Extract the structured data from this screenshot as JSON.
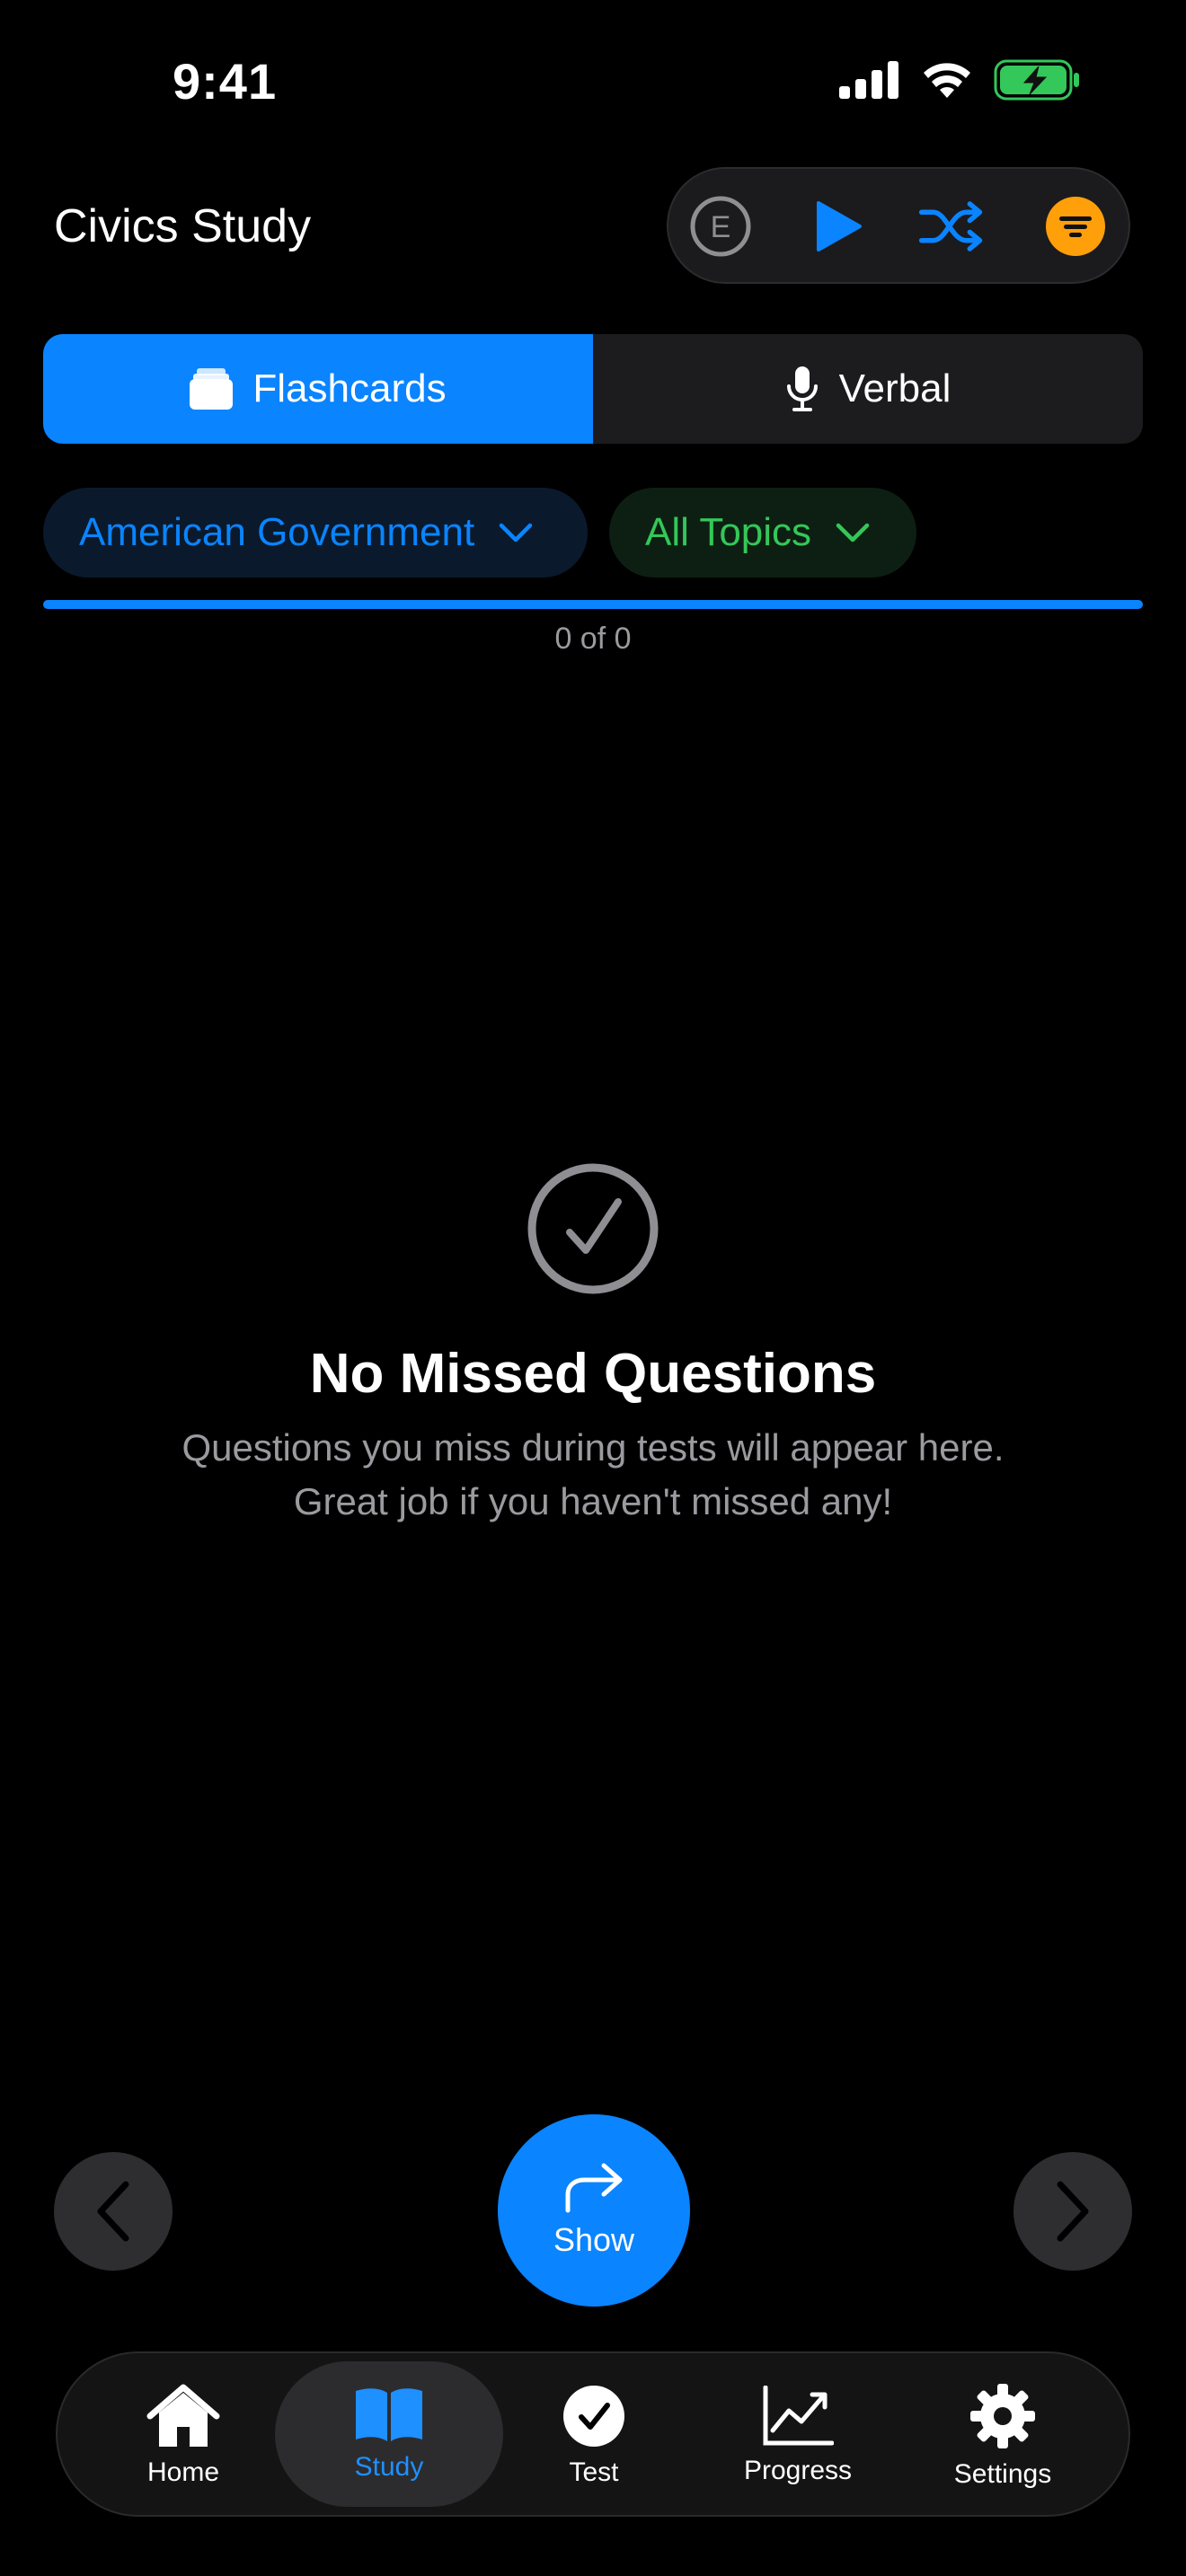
{
  "status_bar": {
    "time": "9:41"
  },
  "header": {
    "title": "Civics Study",
    "toolbar": {
      "e_label": "E",
      "icons": [
        "e-circle-icon",
        "play-icon",
        "shuffle-icon",
        "filter-icon"
      ]
    }
  },
  "segments": [
    {
      "label": "Flashcards",
      "icon": "cards-icon",
      "active": true
    },
    {
      "label": "Verbal",
      "icon": "microphone-icon",
      "active": false
    }
  ],
  "filters": {
    "category": "American Government",
    "topic": "All Topics"
  },
  "progress": {
    "text": "0 of 0",
    "fraction": 1.0
  },
  "empty_state": {
    "title": "No Missed Questions",
    "line1": "Questions you miss during tests will appear here.",
    "line2": "Great job if you haven't missed any!"
  },
  "controls": {
    "show_label": "Show"
  },
  "tabbar": {
    "items": [
      {
        "label": "Home",
        "icon": "house-icon"
      },
      {
        "label": "Study",
        "icon": "book-icon",
        "active": true
      },
      {
        "label": "Test",
        "icon": "checkmark-circle-icon"
      },
      {
        "label": "Progress",
        "icon": "chart-line-icon"
      },
      {
        "label": "Settings",
        "icon": "gear-icon"
      }
    ]
  },
  "colors": {
    "accent": "#0a84ff",
    "green": "#34c759",
    "orange": "#ff9f0a",
    "background": "#000000"
  }
}
